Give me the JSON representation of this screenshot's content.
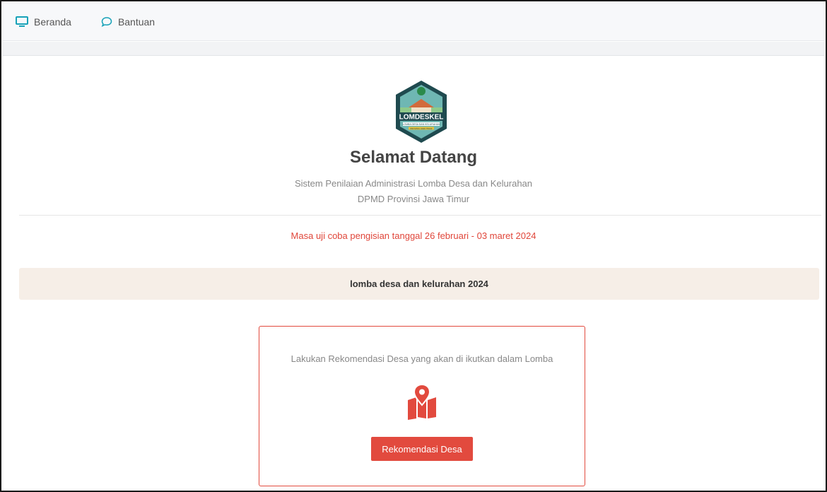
{
  "nav": {
    "home": {
      "label": "Beranda",
      "icon": "monitor-icon"
    },
    "help": {
      "label": "Bantuan",
      "icon": "speech-bubble-icon"
    }
  },
  "logo": {
    "text": "LOMDESKEL",
    "tagline": "LOMBA DESA DAN KELURAHAN",
    "sub": "PROVINSI JAWA TIMUR"
  },
  "welcome": {
    "title": "Selamat Datang",
    "subtitle_line1": "Sistem Penilaian Administrasi Lomba Desa dan Kelurahan",
    "subtitle_line2": "DPMD Provinsi Jawa Timur"
  },
  "notice": "Masa uji coba pengisian tanggal 26 februari - 03 maret 2024",
  "banner": "lomba desa dan kelurahan 2024",
  "card": {
    "text": "Lakukan Rekomendasi Desa yang akan di ikutkan dalam Lomba",
    "icon": "map-pin-icon",
    "button_label": "Rekomendasi Desa"
  },
  "colors": {
    "accent": "#e24a3e",
    "nav_icon": "#17a2b8",
    "banner_bg": "#f6eee7"
  }
}
